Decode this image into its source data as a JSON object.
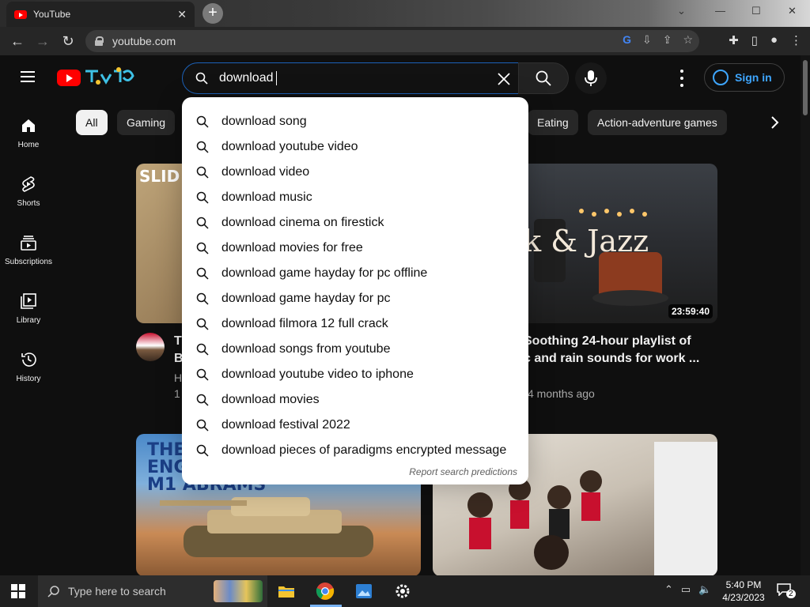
{
  "browser": {
    "tab_title": "YouTube",
    "url": "youtube.com"
  },
  "masthead": {
    "search_value": "download",
    "sign_in": "Sign in"
  },
  "chips": [
    "All",
    "Gaming",
    "Eating",
    "Action-adventure games"
  ],
  "sidebar": [
    {
      "label": "Home",
      "icon": "home-icon"
    },
    {
      "label": "Shorts",
      "icon": "shorts-icon"
    },
    {
      "label": "Subscriptions",
      "icon": "subscriptions-icon"
    },
    {
      "label": "Library",
      "icon": "library-icon"
    },
    {
      "label": "History",
      "icon": "history-icon"
    }
  ],
  "suggestions": [
    "download song",
    "download youtube video",
    "download video",
    "download music",
    "download cinema on firestick",
    "download movies for free",
    "download game hayday for pc offline",
    "download game hayday for pc",
    "download filmora 12 full crack",
    "download songs from youtube",
    "download youtube video to iphone",
    "download movies",
    "download festival 2022",
    "download pieces of paradigms encrypted message"
  ],
  "report_predictions": "Report search predictions",
  "videos": {
    "v1": {
      "thumb_text": "SLID",
      "title_l1": "T",
      "title_l2": "B",
      "meta_l1": "H",
      "meta_l2": "1"
    },
    "v2": {
      "thumb_text": "rk & Jazz",
      "duration": "23:59:40",
      "title_l1": "Soothing 24-hour playlist of",
      "title_l2": "c and rain sounds for work ...",
      "meta": "4 months ago"
    },
    "v3": {
      "thumb_text_l1": "THE",
      "thumb_text_l2": "ENG",
      "thumb_text_l3": "M1 ABRAMS"
    }
  },
  "taskbar": {
    "search_placeholder": "Type here to search",
    "time": "5:40 PM",
    "date": "4/23/2023",
    "notif_count": "2"
  },
  "colors": {
    "accent": "#3ea6ff",
    "brand": "#ff0000",
    "search_border": "#1c62b9"
  }
}
